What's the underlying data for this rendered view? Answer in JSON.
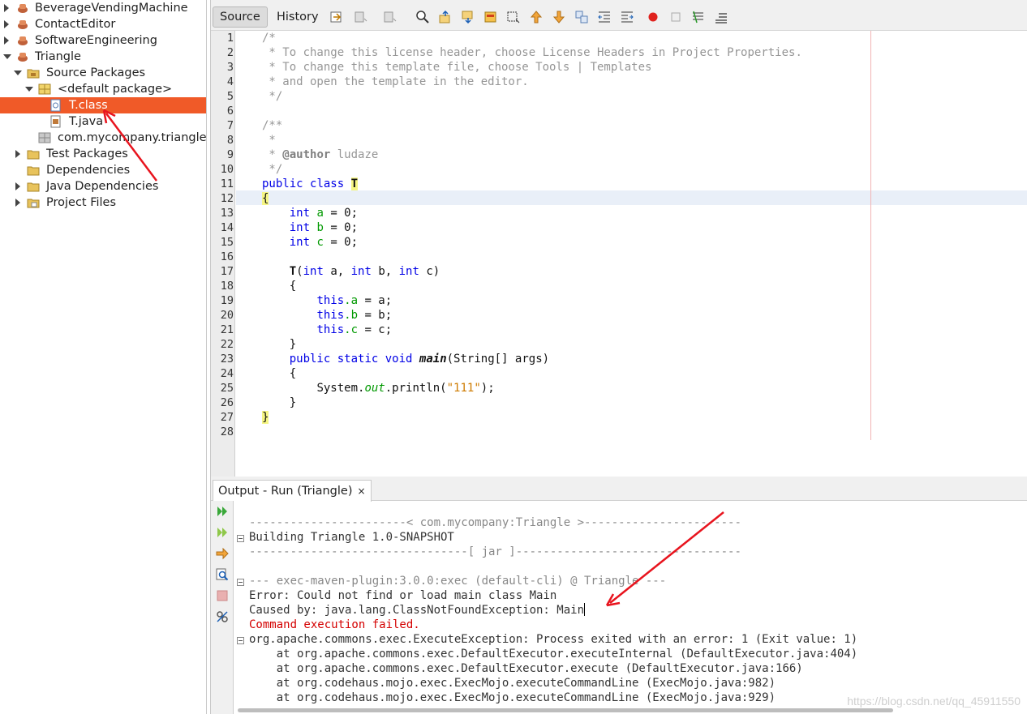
{
  "tree": {
    "nodes": [
      {
        "label": "BeverageVendingMachine",
        "icon": "maven-project-icon"
      },
      {
        "label": "ContactEditor",
        "icon": "maven-project-icon"
      },
      {
        "label": "SoftwareEngineering",
        "icon": "maven-project-icon"
      },
      {
        "label": "Triangle",
        "icon": "maven-project-icon"
      },
      {
        "label": "Source Packages",
        "icon": "source-folder-icon"
      },
      {
        "label": "<default package>",
        "icon": "package-icon"
      },
      {
        "label": "T.class",
        "icon": "class-file-icon"
      },
      {
        "label": "T.java",
        "icon": "java-file-icon"
      },
      {
        "label": "com.mycompany.triangle",
        "icon": "package-icon"
      },
      {
        "label": "Test Packages",
        "icon": "folder-icon"
      },
      {
        "label": "Dependencies",
        "icon": "folder-icon"
      },
      {
        "label": "Java Dependencies",
        "icon": "folder-icon"
      },
      {
        "label": "Project Files",
        "icon": "folder-icon"
      }
    ]
  },
  "editor": {
    "tabs": {
      "source": "Source",
      "history": "History"
    },
    "line_numbers": [
      "1",
      "2",
      "3",
      "4",
      "5",
      "6",
      "7",
      "8",
      "9",
      "10",
      "11",
      "12",
      "13",
      "14",
      "15",
      "16",
      "17",
      "18",
      "19",
      "20",
      "21",
      "22",
      "23",
      "24",
      "25",
      "26",
      "27",
      "28"
    ],
    "lines": {
      "l1": "/*",
      "l2": " * To change this license header, choose License Headers in Project Properties.",
      "l3": " * To change this template file, choose Tools | Templates",
      "l4": " * and open the template in the editor.",
      "l5": " */",
      "l7": "/**",
      "l8": " *",
      "l9_pre": " * ",
      "l9_tag": "@author",
      "l9_val": " ludaze",
      "l10": " */",
      "public": "public",
      "class": "class",
      "T": "T",
      "open_brace": "{",
      "close_brace": "}",
      "int": "int",
      "a": "a",
      "b": "b",
      "c": "c",
      "assign_zero": " = 0;",
      "ctor_args_1": " a, ",
      "ctor_args_2": " b, ",
      "ctor_args_3": " c)",
      "open_paren": "(",
      "this": "this",
      "dot_a": ".a",
      "dot_b": ".b",
      "dot_c": ".c",
      "assign_a": " = a;",
      "assign_b": " = b;",
      "assign_c": " = c;",
      "static": "static",
      "void": "void",
      "main": "main",
      "main_args": "(String[] args)",
      "system": "System.",
      "out": "out",
      "println": ".println(",
      "str111": "\"111\"",
      "close_call": ");"
    }
  },
  "output": {
    "tab_label": "Output - Run (Triangle)",
    "close": "×",
    "lines": {
      "o1": "-----------------------< com.mycompany:Triangle >-----------------------",
      "o2": "Building Triangle 1.0-SNAPSHOT",
      "o3": "--------------------------------[ jar ]---------------------------------",
      "o4": "--- exec-maven-plugin:3.0.0:exec (default-cli) @ Triangle ---",
      "o5": "Error: Could not find or load main class Main",
      "o6": "Caused by: java.lang.ClassNotFoundException: Main",
      "o7": "Command execution failed.",
      "o8": "org.apache.commons.exec.ExecuteException: Process exited with an error: 1 (Exit value: 1)",
      "o9": "    at org.apache.commons.exec.DefaultExecutor.executeInternal (DefaultExecutor.java:404)",
      "o10": "    at org.apache.commons.exec.DefaultExecutor.execute (DefaultExecutor.java:166)",
      "o11": "    at org.codehaus.mojo.exec.ExecMojo.executeCommandLine (ExecMojo.java:982)",
      "o12": "    at org.codehaus.mojo.exec.ExecMojo.executeCommandLine (ExecMojo.java:929)"
    }
  },
  "watermark": "https://blog.csdn.net/qq_45911550",
  "colors": {
    "selection": "#f05a28",
    "keyword": "#0000e6",
    "field": "#009900",
    "string": "#ce7b00",
    "error": "#d40000",
    "annotation_arrow": "#e8141e"
  }
}
